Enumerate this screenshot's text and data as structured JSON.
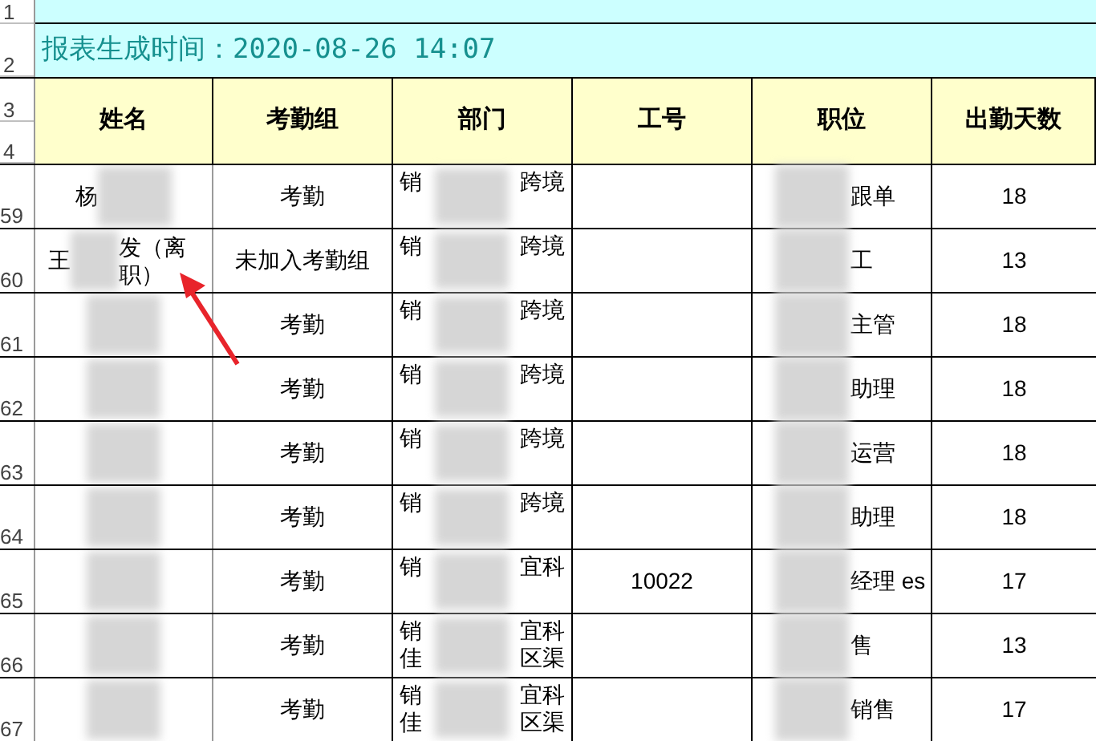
{
  "banner": {
    "row_numbers": [
      "1",
      "2"
    ],
    "text": "报表生成时间：2020-08-26 14:07"
  },
  "header": {
    "row_numbers": [
      "3",
      "4"
    ],
    "columns": [
      "姓名",
      "考勤组",
      "部门",
      "工号",
      "职位",
      "出勤天数"
    ]
  },
  "rows": [
    {
      "row_number": "59",
      "name_before": "杨",
      "name_redacted": true,
      "group": "考勤",
      "dept": [
        {
          "before": "销",
          "after": "跨境"
        }
      ],
      "position_after": "跟单",
      "days": "18"
    },
    {
      "row_number": "60",
      "name_before": "王",
      "name_redacted": true,
      "name_after": "发（离职）",
      "group": "未加入考勤组",
      "dept": [
        {
          "before": "销",
          "after": "跨境"
        }
      ],
      "position_after": "工",
      "days": "13"
    },
    {
      "row_number": "61",
      "name_redacted": true,
      "group": "考勤",
      "dept": [
        {
          "before": "销",
          "after": "跨境"
        }
      ],
      "position_after": "主管",
      "days": "18"
    },
    {
      "row_number": "62",
      "name_redacted": true,
      "group": "考勤",
      "dept": [
        {
          "before": "销",
          "after": "跨境"
        }
      ],
      "position_after": "助理",
      "days": "18"
    },
    {
      "row_number": "63",
      "name_redacted": true,
      "group": "考勤",
      "dept": [
        {
          "before": "销",
          "after": "跨境"
        }
      ],
      "position_after": "运营",
      "days": "18"
    },
    {
      "row_number": "64",
      "name_redacted": true,
      "group": "考勤",
      "dept": [
        {
          "before": "销",
          "after": "跨境"
        }
      ],
      "position_after": "助理",
      "days": "18"
    },
    {
      "row_number": "65",
      "name_redacted": true,
      "group": "考勤",
      "dept": [
        {
          "before": "销",
          "after": "宜科"
        }
      ],
      "id": "10022",
      "position_after": "经理 es",
      "days": "17"
    },
    {
      "row_number": "66",
      "name_redacted": true,
      "group": "考勤",
      "dept": [
        {
          "before": "销",
          "after": "宜科"
        },
        {
          "before": "佳",
          "after": "区渠"
        }
      ],
      "position_after": "售",
      "days": "13"
    },
    {
      "row_number": "67",
      "name_redacted": true,
      "group": "考勤",
      "dept": [
        {
          "before": "销",
          "after": "宜科"
        },
        {
          "before": "佳",
          "after": "区渠"
        }
      ],
      "position_after": "销售",
      "days": "17"
    }
  ]
}
